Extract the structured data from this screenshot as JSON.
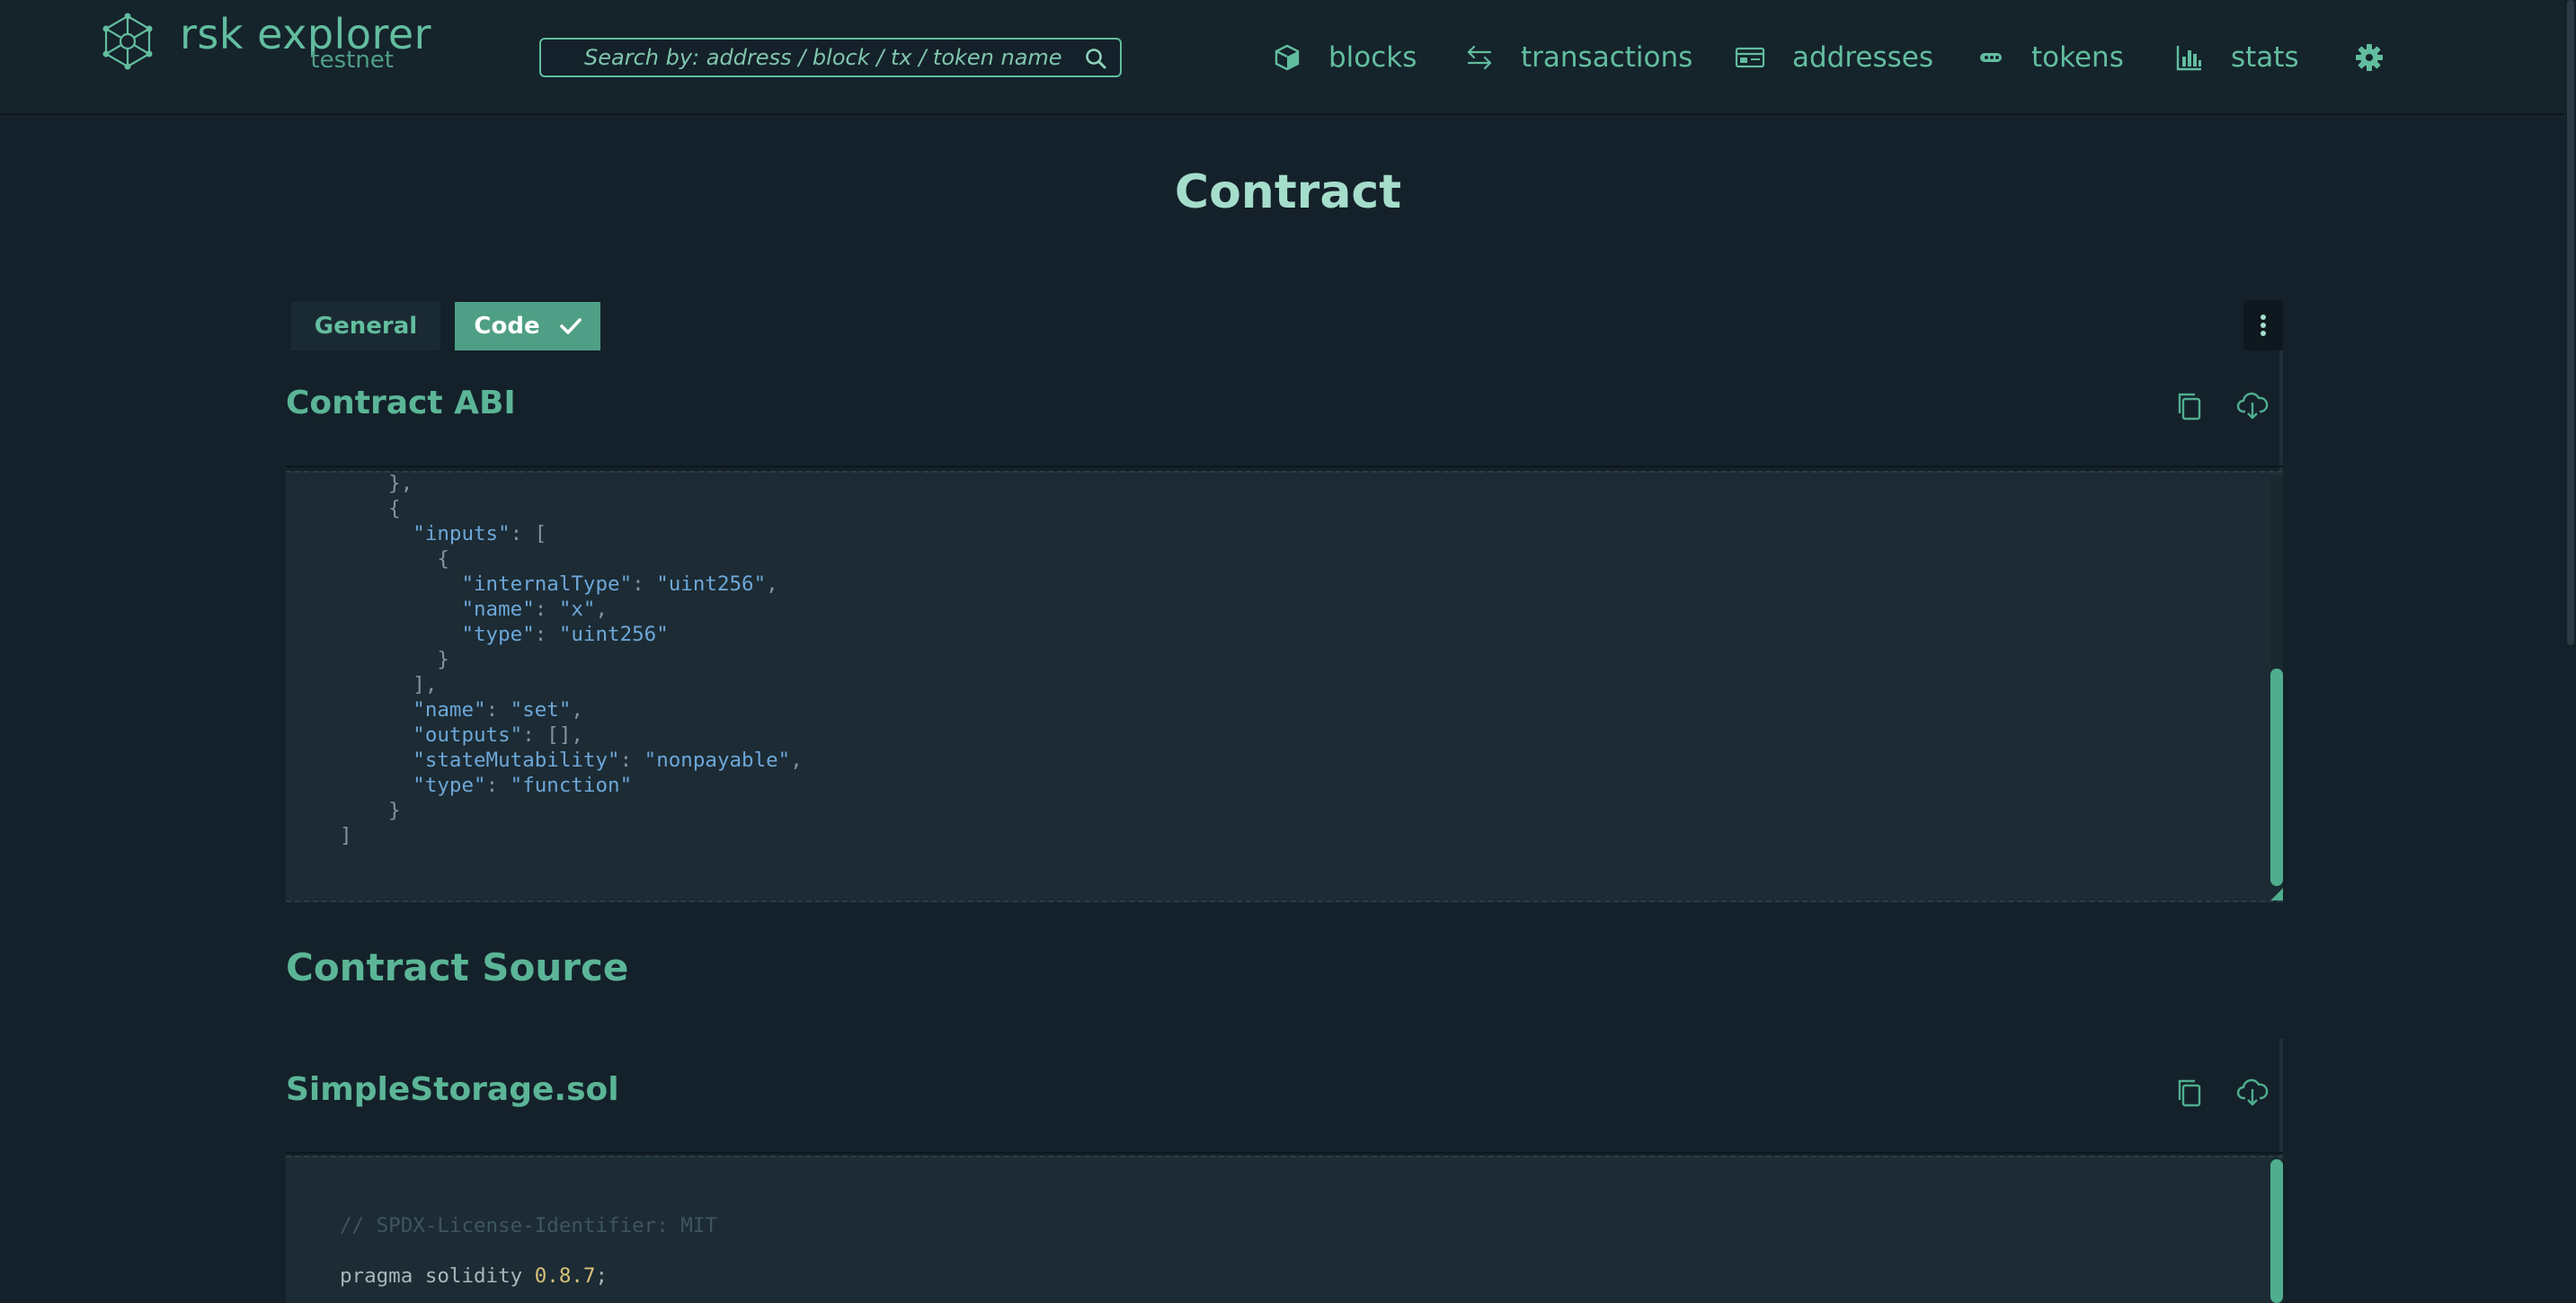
{
  "brand": {
    "name": "rsk explorer",
    "network": "testnet"
  },
  "search": {
    "placeholder": "Search by: address / block / tx / token name"
  },
  "nav": {
    "blocks": "blocks",
    "transactions": "transactions",
    "addresses": "addresses",
    "tokens": "tokens",
    "stats": "stats"
  },
  "page": {
    "title": "Contract"
  },
  "tabs": {
    "general": "General",
    "code": "Code"
  },
  "abi": {
    "title": "Contract ABI",
    "lines": [
      [
        [
          "punct",
          "    },"
        ]
      ],
      [
        [
          "punct",
          "    {"
        ]
      ],
      [
        [
          "plain",
          "      "
        ],
        [
          "key",
          "\"inputs\""
        ],
        [
          "punct",
          ": ["
        ]
      ],
      [
        [
          "punct",
          "        {"
        ]
      ],
      [
        [
          "plain",
          "          "
        ],
        [
          "key",
          "\"internalType\""
        ],
        [
          "punct",
          ": "
        ],
        [
          "str",
          "\"uint256\""
        ],
        [
          "punct",
          ","
        ]
      ],
      [
        [
          "plain",
          "          "
        ],
        [
          "key",
          "\"name\""
        ],
        [
          "punct",
          ": "
        ],
        [
          "str",
          "\"x\""
        ],
        [
          "punct",
          ","
        ]
      ],
      [
        [
          "plain",
          "          "
        ],
        [
          "key",
          "\"type\""
        ],
        [
          "punct",
          ": "
        ],
        [
          "str",
          "\"uint256\""
        ]
      ],
      [
        [
          "punct",
          "        }"
        ]
      ],
      [
        [
          "punct",
          "      ],"
        ]
      ],
      [
        [
          "plain",
          "      "
        ],
        [
          "key",
          "\"name\""
        ],
        [
          "punct",
          ": "
        ],
        [
          "str",
          "\"set\""
        ],
        [
          "punct",
          ","
        ]
      ],
      [
        [
          "plain",
          "      "
        ],
        [
          "key",
          "\"outputs\""
        ],
        [
          "punct",
          ": [],"
        ]
      ],
      [
        [
          "plain",
          "      "
        ],
        [
          "key",
          "\"stateMutability\""
        ],
        [
          "punct",
          ": "
        ],
        [
          "str",
          "\"nonpayable\""
        ],
        [
          "punct",
          ","
        ]
      ],
      [
        [
          "plain",
          "      "
        ],
        [
          "key",
          "\"type\""
        ],
        [
          "punct",
          ": "
        ],
        [
          "str",
          "\"function\""
        ]
      ],
      [
        [
          "punct",
          "    }"
        ]
      ],
      [
        [
          "punct",
          "]"
        ]
      ]
    ]
  },
  "source": {
    "title": "Contract Source",
    "file_name": "SimpleStorage.sol",
    "lines": [
      [
        [
          "comment",
          "// SPDX-License-Identifier: MIT"
        ]
      ],
      [
        [
          "plain",
          ""
        ]
      ],
      [
        [
          "plain",
          "pragma solidity "
        ],
        [
          "num",
          "0.8.7"
        ],
        [
          "plain",
          ";"
        ]
      ]
    ]
  }
}
